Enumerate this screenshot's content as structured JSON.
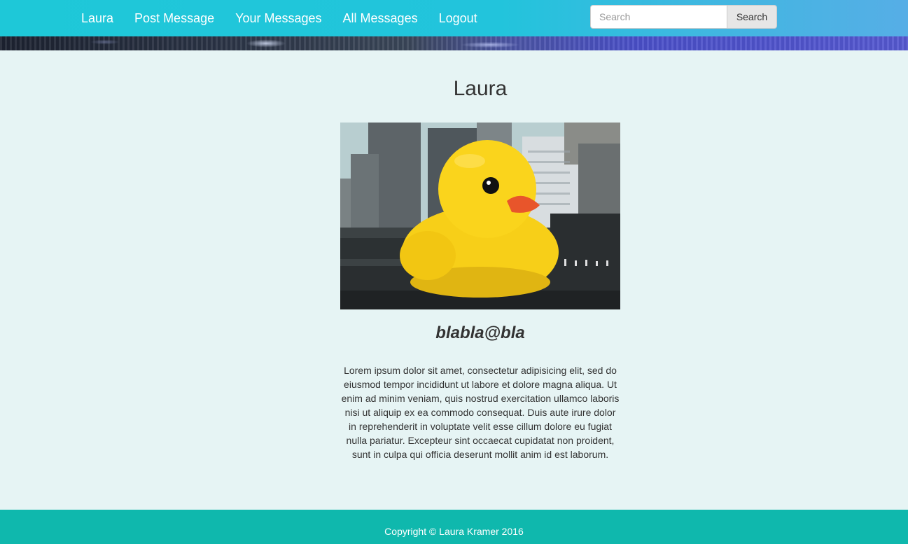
{
  "nav": {
    "items": [
      {
        "label": "Laura"
      },
      {
        "label": "Post Message"
      },
      {
        "label": "Your Messages"
      },
      {
        "label": "All Messages"
      },
      {
        "label": "Logout"
      }
    ],
    "search": {
      "placeholder": "Search",
      "value": "",
      "button_label": "Search"
    }
  },
  "profile": {
    "name": "Laura",
    "email": "blabla@bla",
    "photo_icon": "rubber-duck-photo",
    "bio": "Lorem ipsum dolor sit amet, consectetur adipisicing elit, sed do eiusmod tempor incididunt ut labore et dolore magna aliqua. Ut enim ad minim veniam, quis nostrud exercitation ullamco laboris nisi ut aliquip ex ea commodo consequat. Duis aute irure dolor in reprehenderit in voluptate velit esse cillum dolore eu fugiat nulla pariatur. Excepteur sint occaecat cupidatat non proident, sunt in culpa qui officia deserunt mollit anim id est laborum."
  },
  "footer": {
    "copyright": "Copyright © Laura Kramer 2016"
  },
  "colors": {
    "navbar": "#1ec8d8",
    "page_background": "#e6f4f4",
    "footer": "#0fb8ad",
    "text": "#333333"
  }
}
